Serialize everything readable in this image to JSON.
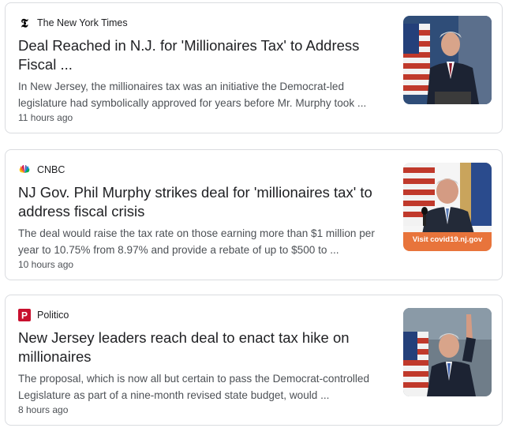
{
  "articles": [
    {
      "source": "The New York Times",
      "source_icon": "nyt-logo-icon",
      "headline": "Deal Reached in N.J. for 'Millionaires Tax' to Address Fiscal ...",
      "snippet": "In New Jersey, the millionaires tax was an initiative the Democrat-led legislature had symbolically approved for years before Mr. Murphy took ...",
      "time": "11 hours ago",
      "thumbnail": "photo-governor-at-podium-with-flag"
    },
    {
      "source": "CNBC",
      "source_icon": "cnbc-peacock-icon",
      "headline": "NJ Gov. Phil Murphy strikes deal for 'millionaires tax' to address fiscal crisis",
      "snippet": "The deal would raise the tax rate on those earning more than $1 million per year to 10.75% from 8.97% and provide a rebate of up to $500 to ...",
      "time": "10 hours ago",
      "thumbnail": "photo-governor-press-briefing",
      "thumbnail_caption": "Visit covid19.nj.gov"
    },
    {
      "source": "Politico",
      "source_icon": "politico-p-icon",
      "headline": "New Jersey leaders reach deal to enact tax hike on millionaires",
      "snippet": "The proposal, which is now all but certain to pass the Democrat-controlled Legislature as part of a nine-month revised state budget, would ...",
      "time": "8 hours ago",
      "thumbnail": "photo-governor-waving"
    }
  ],
  "colors": {
    "card_border": "#dadce0",
    "headline": "#202124",
    "snippet": "#4d5156",
    "politico_red": "#c8102e",
    "caption_orange": "#e8743b"
  }
}
